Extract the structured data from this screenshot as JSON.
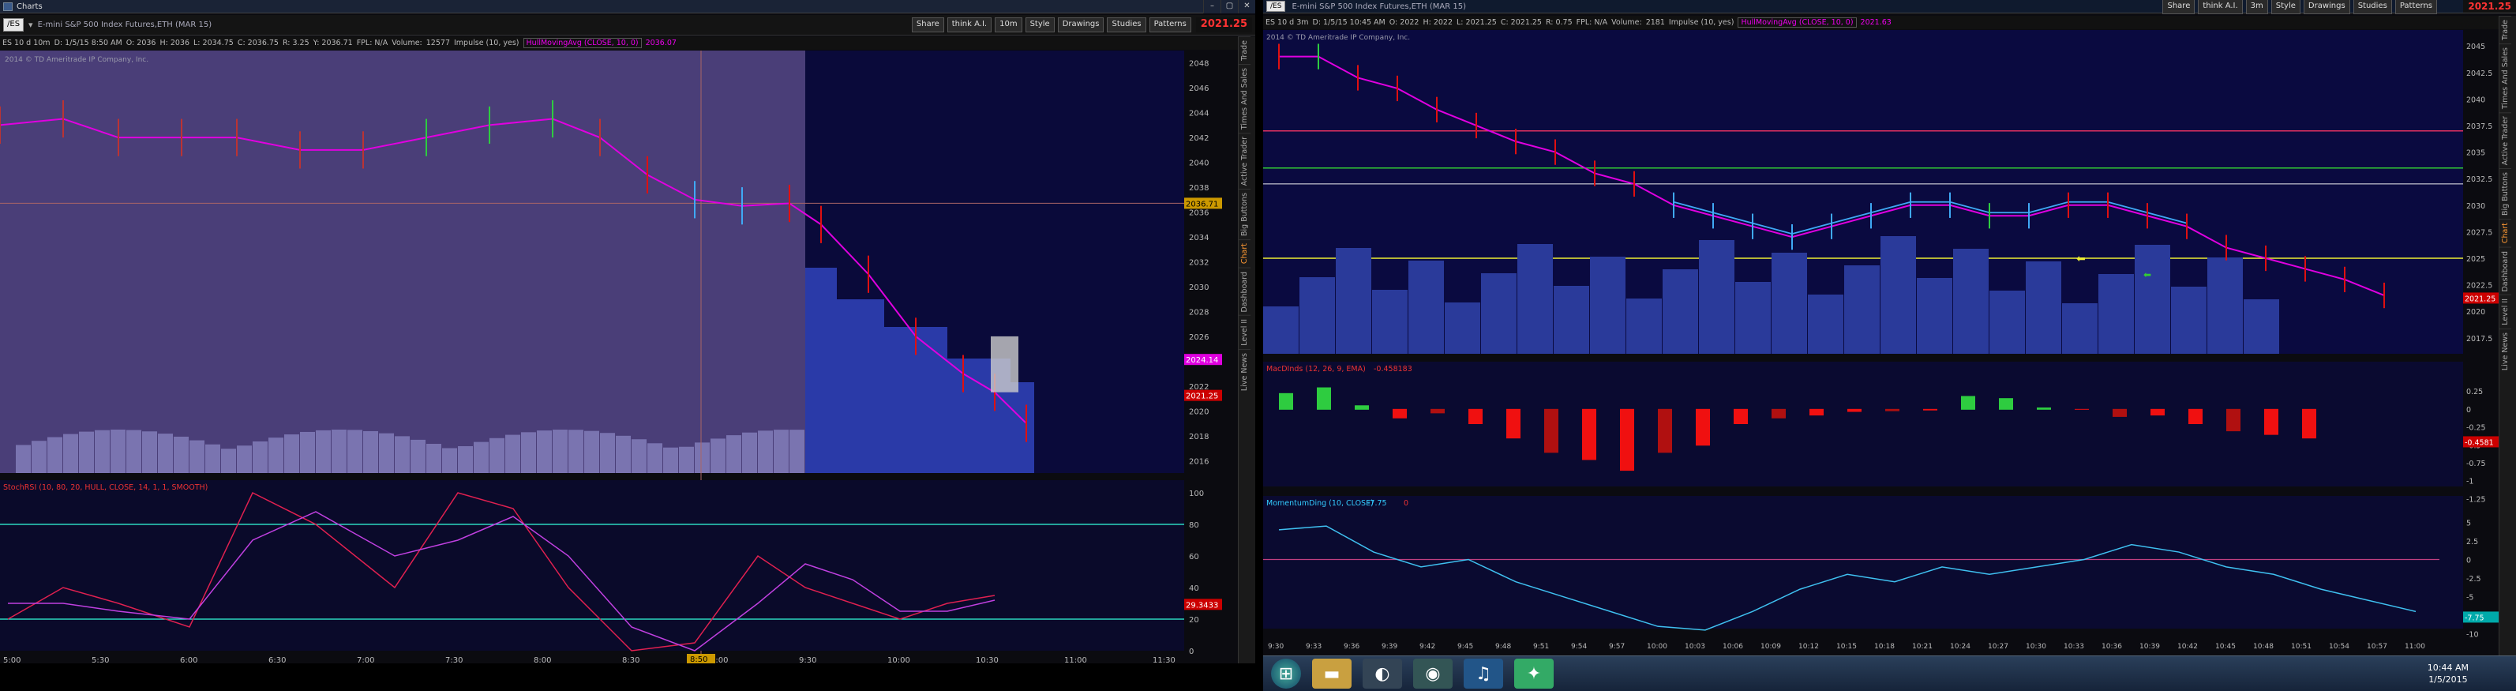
{
  "left": {
    "title": "Charts",
    "symbol": "/ES",
    "description": "E-mini S&P 500 Index Futures,ETH (MAR 15)",
    "tools": [
      "Share",
      "think A.I.",
      "10m",
      "Style",
      "Drawings",
      "Studies",
      "Patterns"
    ],
    "last_price": "2021.25",
    "info": {
      "period": "ES 10 d 10m",
      "date": "D: 1/5/15 8:50 AM",
      "open": "O: 2036",
      "high": "H: 2036",
      "low": "L: 2034.75",
      "close": "C: 2036.75",
      "range": "R: 3.25",
      "y": "Y: 2036.71",
      "fpl": "FPL: N/A",
      "volume": "Volume:",
      "volume_val": "12577",
      "impulse": "Impulse (10, yes)",
      "ma": "HullMovingAvg (CLOSE, 10, 0)",
      "ma_val": "2036.07"
    },
    "copyright": "2014 © TD Ameritrade IP Company, Inc.",
    "price_ticks": [
      "2048",
      "2046",
      "2044",
      "2042",
      "2040",
      "2038",
      "2036",
      "2034",
      "2032",
      "2030",
      "2028",
      "2026",
      "2024",
      "2022",
      "2020",
      "2018",
      "2016"
    ],
    "crosshair_label": "2036.71",
    "ma_label": "2024.14",
    "last_label": "2021.25",
    "study": {
      "name": "StochRSI (10, 80, 20, HULL, CLOSE, 14, 1, 1, SMOOTH)",
      "v1": "1",
      "v2": "0",
      "v3": "80",
      "v4": "20"
    },
    "stoch_ticks": [
      "100",
      "80",
      "60",
      "40",
      "20",
      "0"
    ],
    "stoch_label": "29.3433",
    "time_ticks": [
      "5:00",
      "5:30",
      "6:00",
      "6:30",
      "7:00",
      "7:30",
      "8:00",
      "8:30",
      "9:00",
      "9:30",
      "10:00",
      "10:30",
      "11:00",
      "11:30"
    ],
    "time_cursor": "8:50",
    "side_tabs": [
      "Trade",
      "Times And Sales",
      "Active Trader",
      "Big Buttons",
      "Chart",
      "Dashboard",
      "Level II",
      "Live News"
    ]
  },
  "right": {
    "symbol": "/ES",
    "description": "E-mini S&P 500 Index Futures,ETH (MAR 15)",
    "tools": [
      "Share",
      "think A.I.",
      "3m",
      "Style",
      "Drawings",
      "Studies",
      "Patterns"
    ],
    "last_price": "2021.25",
    "info": {
      "period": "ES 10 d 3m",
      "date": "D: 1/5/15 10:45 AM",
      "open": "O: 2022",
      "high": "H: 2022",
      "low": "L: 2021.25",
      "close": "C: 2021.25",
      "range": "R: 0.75",
      "fpl": "FPL: N/A",
      "volume": "Volume:",
      "volume_val": "2181",
      "impulse": "Impulse (10, yes)",
      "ma": "HullMovingAvg (CLOSE, 10, 0)",
      "ma_val": "2021.63"
    },
    "copyright": "2014 © TD Ameritrade IP Company, Inc.",
    "price_ticks": [
      "2045",
      "2042.5",
      "2040",
      "2037.5",
      "2035",
      "2032.5",
      "2030",
      "2027.5",
      "2025",
      "2022.5",
      "2020",
      "2017.5"
    ],
    "last_label": "2021.25",
    "macd": {
      "name": "MacDInds (12, 26, 9, EMA)",
      "val": "-0.458183"
    },
    "macd_ticks": [
      "0.25",
      "0",
      "-0.25",
      "-0.5",
      "-0.75",
      "-1",
      "-1.25"
    ],
    "macd_label": "-0.4581",
    "momentum": {
      "name": "MomentumDing (10, CLOSE)",
      "val": "-7.75",
      "flag": "0"
    },
    "mom_ticks": [
      "5",
      "2.5",
      "0",
      "-2.5",
      "-5",
      "-7.5",
      "-10"
    ],
    "mom_label": "-7.75",
    "time_ticks": [
      "9:30",
      "9:33",
      "9:36",
      "9:39",
      "9:42",
      "9:45",
      "9:48",
      "9:51",
      "9:54",
      "9:57",
      "10:00",
      "10:03",
      "10:06",
      "10:09",
      "10:12",
      "10:15",
      "10:18",
      "10:21",
      "10:24",
      "10:27",
      "10:30",
      "10:33",
      "10:36",
      "10:39",
      "10:42",
      "10:45",
      "10:48",
      "10:51",
      "10:54",
      "10:57",
      "11:00"
    ],
    "side_tabs": [
      "Trade",
      "Times And Sales",
      "Active Trader",
      "Big Buttons",
      "Chart",
      "Dashboard",
      "Level II",
      "Live News"
    ]
  },
  "taskbar": {
    "time": "10:44 AM",
    "date": "1/5/2015"
  },
  "colors": {
    "up": "#2ecc40",
    "down": "#e01010",
    "neutral": "#3fa9f5",
    "hull": "#e000e0",
    "bg_left": "#4a3e78",
    "bg_right": "#0a0a3a"
  }
}
